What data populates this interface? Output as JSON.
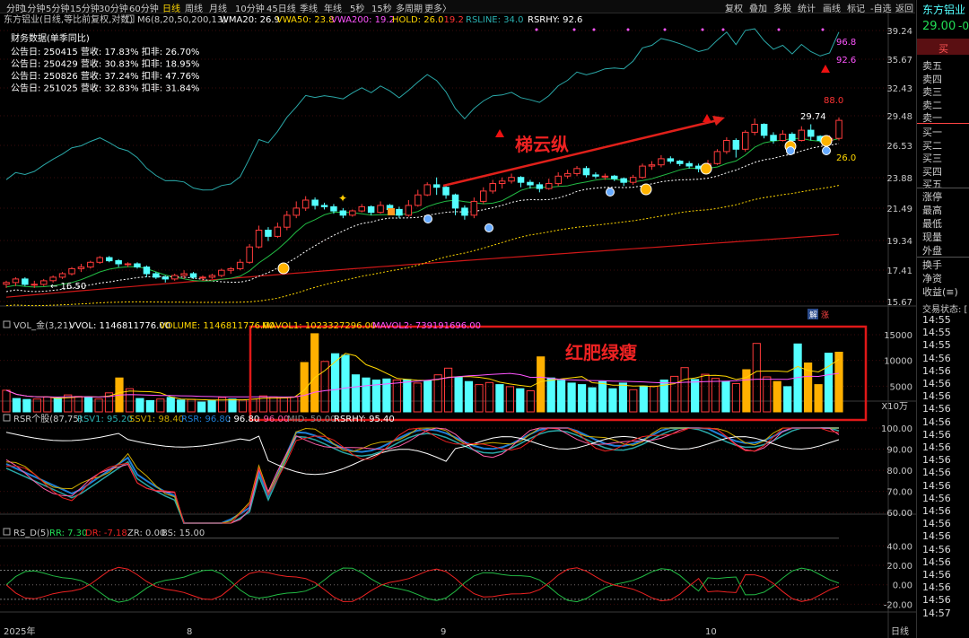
{
  "toolbar": {
    "periods": [
      "分时",
      "1分钟",
      "5分钟",
      "15分钟",
      "30分钟",
      "60分钟",
      "日线",
      "周线",
      "月线",
      "10分钟",
      "45日线",
      "季线",
      "年线",
      "5秒",
      "15秒",
      "多周期",
      "更多〉"
    ],
    "active_period": "日线",
    "actions": [
      "复权",
      "叠加",
      "多股",
      "统计",
      "画线",
      "标记",
      "-自选",
      "返回"
    ]
  },
  "main_legend": {
    "title": "东方铝业(日线,等比前复权,对数)",
    "m6": "M6(8,20,50,200,13)",
    "wma20": "WMA20: 26.9",
    "vwa50": "VWA50: 23.8",
    "vwa200": "VWA200: 19.2",
    "hold": "HOLD: 26.0",
    "hold2": ": 19.2",
    "rsline": "RSLINE: 34.0",
    "rsrhy": "RSRHY: 92.6"
  },
  "finance": {
    "header": "财务数据(单季同比)",
    "rows": [
      "公告日: 250415   营收: 17.83%   扣非: 26.70%",
      "公告日: 250429   营收: 30.83%   扣非: 18.95%",
      "公告日: 250826   营收: 37.24%   扣非: 47.76%",
      "公告日: 251025   营收: 32.83%   扣非: 31.84%"
    ]
  },
  "price_axis": [
    "39.24",
    "35.67",
    "32.43",
    "29.48",
    "26.53",
    "23.88",
    "21.49",
    "19.34",
    "17.41",
    "15.67"
  ],
  "chart_labels": {
    "low_marker": "← 16.50",
    "high_marker": "29.74",
    "v968": "96.8",
    "v926": "92.6",
    "v880": "88.0",
    "v260": "26.0",
    "badge1": "解",
    "badge2": "涨"
  },
  "annotations": {
    "trend_text": "梯云纵",
    "volume_text": "红肥绿瘦"
  },
  "vol_legend": {
    "name": "VOL_金(3,21)",
    "vvol": "VVOL: 1146811776.00",
    "volume": "VOLUME: 1146811776.00",
    "mavol1": "MAVOL1: 1023327296.00",
    "mavol2": "MAVOL2: 739191696.00"
  },
  "vol_axis": [
    "15000",
    "10000",
    "5000",
    "X10万"
  ],
  "rsr_legend": {
    "name": "RSR个股(87,75)",
    "rsv1": "RSV1: 95.20",
    "ssv1": "SSV1: 98.40",
    "rsr": "RSR: 96.80",
    "v968": ": 96.80",
    "v960": ": 96.00",
    "mid": "MID: 50.00",
    "rsrhy": "RSRHY: 95.40"
  },
  "rsr_axis": [
    "100.00",
    "90.00",
    "80.00",
    "70.00",
    "60.00"
  ],
  "rsd_legend": {
    "name": "RS_D(5)",
    "rr": "RR: 7.30",
    "dr": "DR: -7.18",
    "zr": "ZR: 0.00",
    "bs": "BS: 15.00"
  },
  "rsd_axis": [
    "40.00",
    "20.00",
    "0.00",
    "-20.00"
  ],
  "x_axis": {
    "year": "2025年",
    "m8": "8",
    "m9": "9",
    "m10": "10",
    "period": "日线"
  },
  "right_panel": {
    "title": "东方铝业 (",
    "price": "29.00",
    "change": "-0",
    "buy_button": "买",
    "asks": [
      "卖五",
      "卖四",
      "卖三",
      "卖二",
      "卖一"
    ],
    "bids": [
      "买一",
      "买二",
      "买三",
      "买四",
      "买五"
    ],
    "stats": [
      "涨停",
      "最高",
      "最低",
      "现量",
      "外盘"
    ],
    "stats2": [
      "换手",
      "净资",
      "收益(≡)"
    ],
    "trade_status": "交易状态: [",
    "times": [
      "14:55",
      "14:55",
      "14:55",
      "14:56",
      "14:56",
      "14:56",
      "14:56",
      "14:56",
      "14:56",
      "14:56",
      "14:56",
      "14:56",
      "14:56",
      "14:56",
      "14:56",
      "14:56",
      "14:56",
      "14:56",
      "14:56",
      "14:56",
      "14:56",
      "14:56",
      "14:56",
      "14:57"
    ]
  },
  "colors": {
    "up": "#ff3b3b",
    "down": "#54ffff",
    "yellow": "#ffd700",
    "magenta": "#ff55ff",
    "teal": "#2aa8a8",
    "green": "#22bb44",
    "orange": "#ff9900"
  },
  "chart_data": [
    {
      "type": "candlestick",
      "title": "东方铝业(日线,等比前复权,对数)",
      "yticks": [
        39.24,
        35.67,
        32.43,
        29.48,
        26.53,
        23.88,
        21.49,
        19.34,
        17.41,
        15.67
      ],
      "x_months": [
        "2025年",
        "8",
        "9",
        "10"
      ],
      "candles": [
        [
          16.6,
          16.7,
          16.4,
          16.8
        ],
        [
          16.7,
          16.9,
          16.5,
          17.0
        ],
        [
          16.9,
          16.6,
          16.5,
          17.0
        ],
        [
          16.6,
          16.6,
          16.4,
          16.8
        ],
        [
          16.6,
          16.8,
          16.5,
          16.9
        ],
        [
          16.8,
          17.0,
          16.7,
          17.1
        ],
        [
          17.0,
          17.2,
          16.9,
          17.3
        ],
        [
          17.2,
          17.5,
          17.1,
          17.6
        ],
        [
          17.5,
          17.6,
          17.3,
          17.8
        ],
        [
          17.6,
          17.9,
          17.5,
          18.0
        ],
        [
          17.9,
          18.2,
          17.8,
          18.3
        ],
        [
          18.2,
          18.0,
          17.9,
          18.3
        ],
        [
          18.0,
          17.8,
          17.6,
          18.1
        ],
        [
          17.8,
          17.8,
          17.6,
          17.9
        ],
        [
          17.8,
          17.6,
          17.5,
          17.9
        ],
        [
          17.6,
          17.2,
          17.0,
          17.7
        ],
        [
          17.2,
          17.0,
          16.9,
          17.3
        ],
        [
          17.0,
          16.9,
          16.7,
          17.1
        ],
        [
          16.9,
          17.1,
          16.8,
          17.2
        ],
        [
          17.1,
          17.2,
          16.9,
          17.4
        ],
        [
          17.2,
          17.0,
          16.9,
          17.3
        ],
        [
          17.0,
          17.0,
          16.8,
          17.1
        ],
        [
          17.0,
          17.1,
          16.9,
          17.2
        ],
        [
          17.1,
          17.4,
          17.0,
          17.5
        ],
        [
          17.4,
          17.5,
          17.2,
          17.6
        ],
        [
          17.5,
          17.9,
          17.4,
          18.1
        ],
        [
          17.9,
          18.9,
          17.8,
          19.1
        ],
        [
          18.9,
          20.0,
          18.8,
          20.3
        ],
        [
          20.0,
          19.6,
          19.3,
          20.2
        ],
        [
          19.6,
          20.2,
          19.5,
          20.5
        ],
        [
          20.2,
          21.0,
          20.0,
          21.3
        ],
        [
          21.0,
          21.5,
          20.8,
          22.0
        ],
        [
          21.5,
          22.1,
          21.3,
          22.4
        ],
        [
          22.1,
          21.7,
          21.4,
          22.3
        ],
        [
          21.7,
          21.6,
          21.4,
          21.9
        ],
        [
          21.6,
          21.3,
          21.1,
          21.8
        ],
        [
          21.3,
          21.0,
          20.8,
          21.5
        ],
        [
          21.0,
          21.3,
          20.9,
          21.4
        ],
        [
          21.3,
          21.6,
          21.2,
          21.8
        ],
        [
          21.6,
          21.2,
          21.0,
          21.7
        ],
        [
          21.2,
          21.7,
          21.1,
          22.0
        ],
        [
          21.7,
          21.4,
          21.2,
          21.8
        ],
        [
          21.4,
          21.0,
          20.8,
          21.6
        ],
        [
          21.0,
          21.7,
          20.9,
          22.1
        ],
        [
          21.7,
          22.5,
          21.6,
          22.9
        ],
        [
          22.5,
          23.3,
          22.4,
          23.5
        ],
        [
          23.3,
          23.1,
          22.5,
          23.9
        ],
        [
          23.1,
          22.5,
          22.2,
          23.2
        ],
        [
          22.5,
          21.5,
          21.0,
          22.6
        ],
        [
          21.5,
          21.0,
          20.7,
          21.7
        ],
        [
          21.0,
          22.0,
          20.8,
          22.3
        ],
        [
          22.0,
          22.8,
          21.8,
          23.1
        ],
        [
          22.8,
          23.4,
          22.6,
          23.7
        ],
        [
          23.4,
          23.6,
          23.0,
          23.9
        ],
        [
          23.6,
          23.9,
          23.4,
          24.2
        ],
        [
          23.9,
          23.5,
          23.1,
          24.0
        ],
        [
          23.5,
          23.3,
          23.0,
          23.7
        ],
        [
          23.3,
          23.0,
          22.7,
          23.5
        ],
        [
          23.0,
          23.4,
          22.9,
          23.8
        ],
        [
          23.4,
          24.0,
          23.2,
          24.3
        ],
        [
          24.0,
          24.2,
          23.8,
          24.5
        ],
        [
          24.2,
          24.6,
          24.0,
          24.8
        ],
        [
          24.6,
          24.1,
          23.9,
          24.8
        ],
        [
          24.1,
          24.0,
          23.8,
          24.3
        ],
        [
          24.0,
          24.0,
          23.7,
          24.2
        ],
        [
          24.0,
          23.8,
          23.6,
          24.1
        ],
        [
          23.8,
          23.5,
          23.2,
          23.9
        ],
        [
          23.5,
          23.9,
          23.3,
          24.1
        ],
        [
          23.9,
          24.8,
          23.8,
          25.0
        ],
        [
          24.8,
          24.9,
          24.5,
          25.2
        ],
        [
          24.9,
          25.4,
          24.7,
          25.7
        ],
        [
          25.4,
          25.2,
          25.0,
          25.6
        ],
        [
          25.2,
          25.0,
          24.8,
          25.3
        ],
        [
          25.0,
          24.8,
          24.6,
          25.2
        ],
        [
          24.8,
          24.6,
          24.3,
          25.0
        ],
        [
          24.6,
          25.0,
          24.5,
          25.3
        ],
        [
          25.0,
          26.0,
          24.9,
          26.2
        ],
        [
          26.0,
          27.0,
          25.8,
          27.3
        ],
        [
          27.0,
          26.2,
          25.5,
          27.2
        ],
        [
          26.2,
          27.8,
          26.0,
          28.0
        ],
        [
          27.8,
          28.6,
          27.5,
          29.2
        ],
        [
          28.6,
          27.5,
          27.2,
          28.7
        ],
        [
          27.5,
          27.0,
          26.7,
          27.8
        ],
        [
          27.0,
          27.6,
          26.9,
          28.0
        ],
        [
          27.6,
          27.0,
          26.6,
          27.8
        ],
        [
          27.0,
          28.0,
          26.9,
          28.4
        ],
        [
          28.0,
          27.4,
          27.0,
          28.6
        ],
        [
          27.4,
          27.0,
          26.8,
          27.5
        ],
        [
          27.0,
          27.2,
          26.8,
          27.5
        ],
        [
          27.2,
          29.0,
          27.0,
          29.3
        ]
      ]
    },
    {
      "type": "bar",
      "title": "VOL_金(3,21)",
      "unit": "X10万",
      "yticks": [
        15000,
        10000,
        5000
      ],
      "values": [
        4200,
        2600,
        2400,
        2500,
        2900,
        2700,
        3300,
        3000,
        2900,
        2500,
        3700,
        6600,
        4500,
        2600,
        2200,
        2500,
        2800,
        2300,
        2400,
        1900,
        2200,
        2800,
        2500,
        2300,
        2500,
        3100,
        2900,
        2700,
        2900,
        9600,
        15200,
        9800,
        11300,
        11000,
        7200,
        6600,
        6200,
        6400,
        6200,
        6300,
        5600,
        6100,
        7200,
        8500,
        6700,
        5900,
        5300,
        5700,
        5300,
        4900,
        4500,
        4100,
        10700,
        6600,
        6100,
        5600,
        5300,
        4700,
        5900,
        4500,
        5600,
        4300,
        5000,
        5000,
        6200,
        6900,
        8600,
        6300,
        7300,
        6500,
        5900,
        5500,
        8200,
        13300,
        6800,
        5900,
        4900,
        13200,
        9500,
        5300,
        11400,
        11600
      ],
      "colors": [
        "up",
        "down",
        "down",
        "up",
        "up",
        "down",
        "up",
        "up",
        "down",
        "up",
        "up",
        "yellow",
        "up",
        "down",
        "down",
        "up",
        "down",
        "down",
        "up",
        "down",
        "down",
        "up",
        "down",
        "up",
        "up",
        "up",
        "up",
        "up",
        "up",
        "yellow",
        "yellow",
        "up",
        "down",
        "down",
        "down",
        "down",
        "down",
        "down",
        "up",
        "down",
        "up",
        "down",
        "up",
        "up",
        "down",
        "down",
        "up",
        "up",
        "down",
        "up",
        "down",
        "up",
        "yellow",
        "down",
        "down",
        "down",
        "down",
        "down",
        "down",
        "down",
        "down",
        "up",
        "down",
        "up",
        "down",
        "up",
        "up",
        "down",
        "up",
        "up",
        "down",
        "up",
        "yellow",
        "up",
        "up",
        "yellow",
        "down",
        "down",
        "yellow",
        "yellow",
        "down",
        "yellow",
        "down"
      ]
    }
  ]
}
